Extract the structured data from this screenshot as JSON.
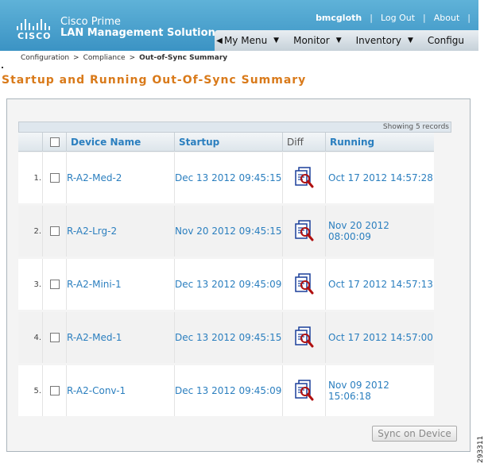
{
  "header": {
    "logo_text": "CISCO",
    "product_line1": "Cisco Prime",
    "product_line2": "LAN Management Solution",
    "user": "bmcgloth",
    "logout": "Log Out",
    "about": "About",
    "separator": "|"
  },
  "nav": {
    "items": [
      {
        "label": "My Menu"
      },
      {
        "label": "Monitor"
      },
      {
        "label": "Inventory"
      },
      {
        "label": "Configu"
      }
    ]
  },
  "breadcrumb": {
    "items": [
      "Configuration",
      "Compliance"
    ],
    "current": "Out-of-Sync Summary",
    "arrow": ">"
  },
  "page_title": "Startup and Running Out-Of-Sync Summary",
  "grid": {
    "records_text": "Showing 5 records",
    "columns": {
      "device": "Device Name",
      "startup": "Startup",
      "diff": "Diff",
      "running": "Running"
    },
    "rows": [
      {
        "num": "1.",
        "device": "R-A2-Med-2",
        "startup": "Dec 13 2012 09:45:15",
        "running": "Oct 17 2012 14:57:28"
      },
      {
        "num": "2.",
        "device": "R-A2-Lrg-2",
        "startup": "Nov 20 2012 09:45:15",
        "running": "Nov 20 2012 08:00:09"
      },
      {
        "num": "3.",
        "device": "R-A2-Mini-1",
        "startup": "Dec 13 2012 09:45:09",
        "running": "Oct 17 2012 14:57:13"
      },
      {
        "num": "4.",
        "device": "R-A2-Med-1",
        "startup": "Dec 13 2012 09:45:15",
        "running": "Oct 17 2012 14:57:00"
      },
      {
        "num": "5.",
        "device": "R-A2-Conv-1",
        "startup": "Dec 13 2012 09:45:09",
        "running": "Nov 09 2012 15:06:18"
      }
    ]
  },
  "actions": {
    "sync_label": "Sync on Device"
  },
  "figure_number": "293311",
  "icons": {
    "back": "triangle-left-icon",
    "caret": "caret-down-icon",
    "diff": "diff-compare-icon"
  },
  "colors": {
    "header": "#3b93c4",
    "link": "#2b7fbf",
    "title": "#d97a1a"
  }
}
